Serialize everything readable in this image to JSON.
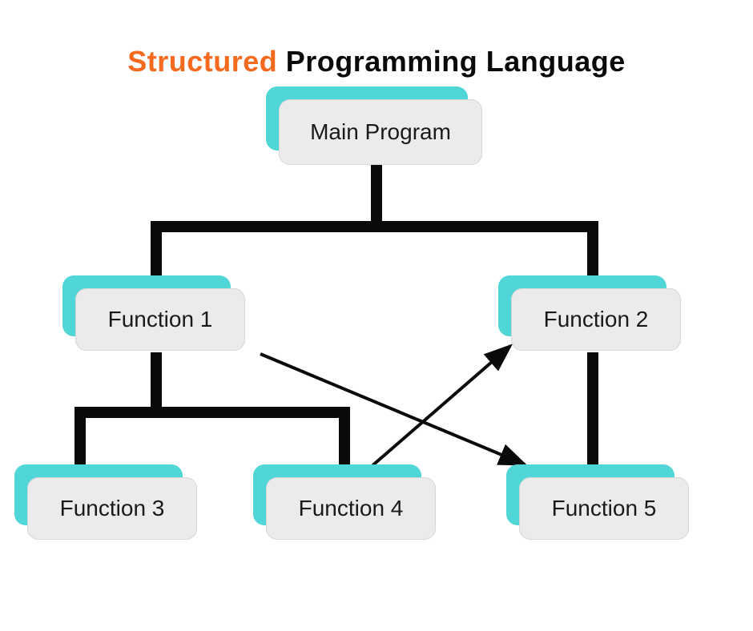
{
  "title": {
    "accent": "Structured",
    "rest": "Programming Language"
  },
  "colors": {
    "accent_text": "#f56a1e",
    "node_shadow": "#51d6d8",
    "node_fill": "#ebebeb",
    "node_border": "#d6d6d6",
    "connector": "#0a0a0a"
  },
  "diagram": {
    "nodes": {
      "main": {
        "label": "Main Program"
      },
      "f1": {
        "label": "Function 1"
      },
      "f2": {
        "label": "Function 2"
      },
      "f3": {
        "label": "Function 3"
      },
      "f4": {
        "label": "Function 4"
      },
      "f5": {
        "label": "Function 5"
      }
    },
    "tree_edges": [
      [
        "main",
        "f1"
      ],
      [
        "main",
        "f2"
      ],
      [
        "f1",
        "f3"
      ],
      [
        "f1",
        "f4"
      ],
      [
        "f2",
        "f5"
      ]
    ],
    "cross_arrows": [
      {
        "from": "f4",
        "to": "f2"
      },
      {
        "from": "f1_area",
        "to": "f5"
      }
    ]
  }
}
